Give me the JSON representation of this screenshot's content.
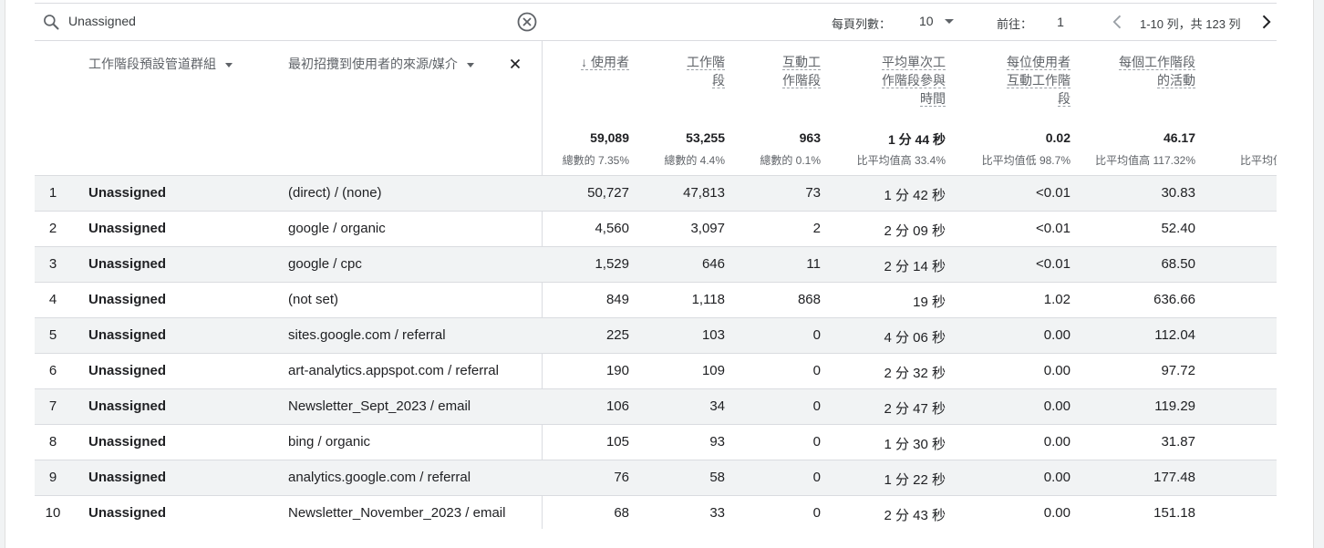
{
  "search": {
    "value": "Unassigned"
  },
  "pagination": {
    "per_page_label": "每頁列數：",
    "per_page_value": "10",
    "goto_label": "前往：",
    "goto_value": "1",
    "range_text": "1-10 列，共 123 列"
  },
  "table": {
    "dimensions": [
      {
        "label": "工作階段預設管道群組"
      },
      {
        "label": "最初招攬到使用者的來源/媒介"
      }
    ],
    "metrics": [
      {
        "lines": [
          "↓ 使用者"
        ],
        "total": "59,089",
        "total_sub": "總數的 7.35%"
      },
      {
        "lines": [
          "工作階",
          "段"
        ],
        "total": "53,255",
        "total_sub": "總數的 4.4%"
      },
      {
        "lines": [
          "互動工",
          "作階段"
        ],
        "total": "963",
        "total_sub": "總數的 0.1%"
      },
      {
        "lines": [
          "平均單次工",
          "作階段參與",
          "時間"
        ],
        "total": "1 分 44 秒",
        "total_sub": "比平均值高 33.4%"
      },
      {
        "lines": [
          "每位使用者",
          "互動工作階",
          "段"
        ],
        "total": "0.02",
        "total_sub": "比平均值低 98.7%"
      },
      {
        "lines": [
          "每個工作階段",
          "的活動"
        ],
        "total": "46.17",
        "total_sub": "比平均值高 117.32%"
      },
      {
        "lines": [
          ""
        ],
        "total": "",
        "total_sub": "比平均值"
      }
    ],
    "rows": [
      {
        "index": "1",
        "group": "Unassigned",
        "source": "(direct) / (none)",
        "users": "50,727",
        "sessions": "47,813",
        "engaged": "73",
        "avg_time": "1 分 42 秒",
        "per_user": "<0.01",
        "events": "30.83"
      },
      {
        "index": "2",
        "group": "Unassigned",
        "source": "google / organic",
        "users": "4,560",
        "sessions": "3,097",
        "engaged": "2",
        "avg_time": "2 分 09 秒",
        "per_user": "<0.01",
        "events": "52.40"
      },
      {
        "index": "3",
        "group": "Unassigned",
        "source": "google / cpc",
        "users": "1,529",
        "sessions": "646",
        "engaged": "11",
        "avg_time": "2 分 14 秒",
        "per_user": "<0.01",
        "events": "68.50"
      },
      {
        "index": "4",
        "group": "Unassigned",
        "source": "(not set)",
        "users": "849",
        "sessions": "1,118",
        "engaged": "868",
        "avg_time": "19 秒",
        "per_user": "1.02",
        "events": "636.66"
      },
      {
        "index": "5",
        "group": "Unassigned",
        "source": "sites.google.com / referral",
        "users": "225",
        "sessions": "103",
        "engaged": "0",
        "avg_time": "4 分 06 秒",
        "per_user": "0.00",
        "events": "112.04"
      },
      {
        "index": "6",
        "group": "Unassigned",
        "source": "art-analytics.appspot.com / referral",
        "users": "190",
        "sessions": "109",
        "engaged": "0",
        "avg_time": "2 分 32 秒",
        "per_user": "0.00",
        "events": "97.72"
      },
      {
        "index": "7",
        "group": "Unassigned",
        "source": "Newsletter_Sept_2023 / email",
        "users": "106",
        "sessions": "34",
        "engaged": "0",
        "avg_time": "2 分 47 秒",
        "per_user": "0.00",
        "events": "119.29"
      },
      {
        "index": "8",
        "group": "Unassigned",
        "source": "bing / organic",
        "users": "105",
        "sessions": "93",
        "engaged": "0",
        "avg_time": "1 分 30 秒",
        "per_user": "0.00",
        "events": "31.87"
      },
      {
        "index": "9",
        "group": "Unassigned",
        "source": "analytics.google.com / referral",
        "users": "76",
        "sessions": "58",
        "engaged": "0",
        "avg_time": "1 分 22 秒",
        "per_user": "0.00",
        "events": "177.48"
      },
      {
        "index": "10",
        "group": "Unassigned",
        "source": "Newsletter_November_2023 / email",
        "users": "68",
        "sessions": "33",
        "engaged": "0",
        "avg_time": "2 分 43 秒",
        "per_user": "0.00",
        "events": "151.18"
      }
    ]
  },
  "colors": {
    "row_alt": "#f1f3f4",
    "border": "#dadce0",
    "text": "#202124",
    "muted": "#5f6368"
  }
}
